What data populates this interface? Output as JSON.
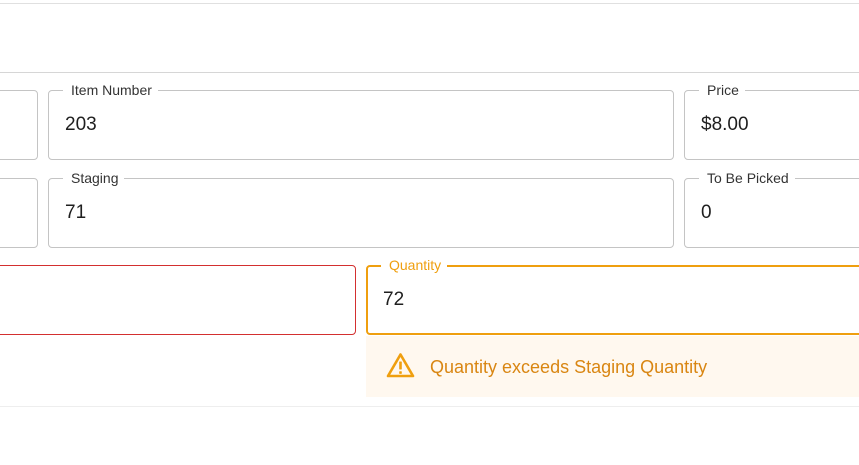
{
  "form": {
    "item_number": {
      "label": "Item Number",
      "value": "203"
    },
    "price": {
      "label": "Price",
      "value": "$8.00"
    },
    "staging": {
      "label": "Staging",
      "value": "71"
    },
    "to_be_picked": {
      "label": "To Be Picked",
      "value": "0"
    },
    "quantity": {
      "label": "Quantity",
      "value": "72"
    }
  },
  "alert": {
    "message": "Quantity exceeds Staging Quantity",
    "icon": "warning-triangle-icon"
  },
  "colors": {
    "warning_accent": "#ef9f0f",
    "error_border": "#d32f2f",
    "alert_background": "#fff8ef",
    "alert_text": "#d98612"
  }
}
